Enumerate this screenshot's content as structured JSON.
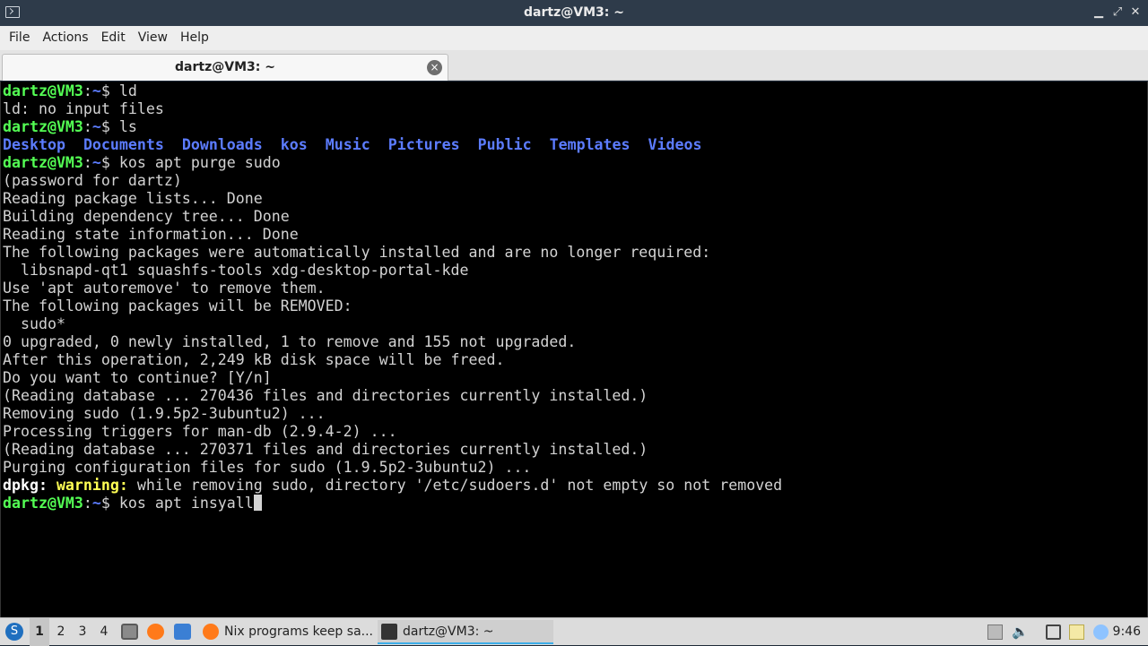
{
  "window": {
    "title": "dartz@VM3: ~",
    "minimize": "▁",
    "maximize": "⤢",
    "close": "✕"
  },
  "menu": [
    "File",
    "Actions",
    "Edit",
    "View",
    "Help"
  ],
  "tab": {
    "label": "dartz@VM3: ~",
    "close": "×"
  },
  "prompt": {
    "user": "dartz@VM3",
    "sep": ":",
    "path": "~",
    "sym": "$"
  },
  "terminal": {
    "cmd1": " ld",
    "out1": "ld: no input files",
    "cmd2": " ls",
    "dirs": [
      "Desktop",
      "Documents",
      "Downloads",
      "kos",
      "Music",
      "Pictures",
      "Public",
      "Templates",
      "Videos"
    ],
    "cmd3": " kos apt purge sudo",
    "lines": [
      "(password for dartz)",
      "Reading package lists... Done",
      "Building dependency tree... Done",
      "Reading state information... Done",
      "The following packages were automatically installed and are no longer required:",
      "  libsnapd-qt1 squashfs-tools xdg-desktop-portal-kde",
      "Use 'apt autoremove' to remove them.",
      "The following packages will be REMOVED:",
      "  sudo*",
      "0 upgraded, 0 newly installed, 1 to remove and 155 not upgraded.",
      "After this operation, 2,249 kB disk space will be freed.",
      "Do you want to continue? [Y/n]",
      "(Reading database ... 270436 files and directories currently installed.)",
      "Removing sudo (1.9.5p2-3ubuntu2) ...",
      "Processing triggers for man-db (2.9.4-2) ...",
      "(Reading database ... 270371 files and directories currently installed.)",
      "Purging configuration files for sudo (1.9.5p2-3ubuntu2) ..."
    ],
    "warn_prefix": "dpkg:",
    "warn_label": " warning:",
    "warn_text": " while removing sudo, directory '/etc/sudoers.d' not empty so not removed",
    "cmd4": " kos apt insyall"
  },
  "taskbar": {
    "desktops": [
      "1",
      "2",
      "3",
      "4"
    ],
    "active_desktop": "1",
    "tasks": [
      {
        "label": "Nix programs keep sa...",
        "icon": "firefox-icon"
      },
      {
        "label": "dartz@VM3: ~",
        "icon": "terminal-icon"
      }
    ],
    "clock": "9:46"
  },
  "colors": {
    "prompt_user": "#54ff54",
    "prompt_path": "#5c7cff",
    "warning": "#ffff54",
    "terminal_bg": "#000000",
    "titlebar_bg": "#2e3b4a"
  }
}
